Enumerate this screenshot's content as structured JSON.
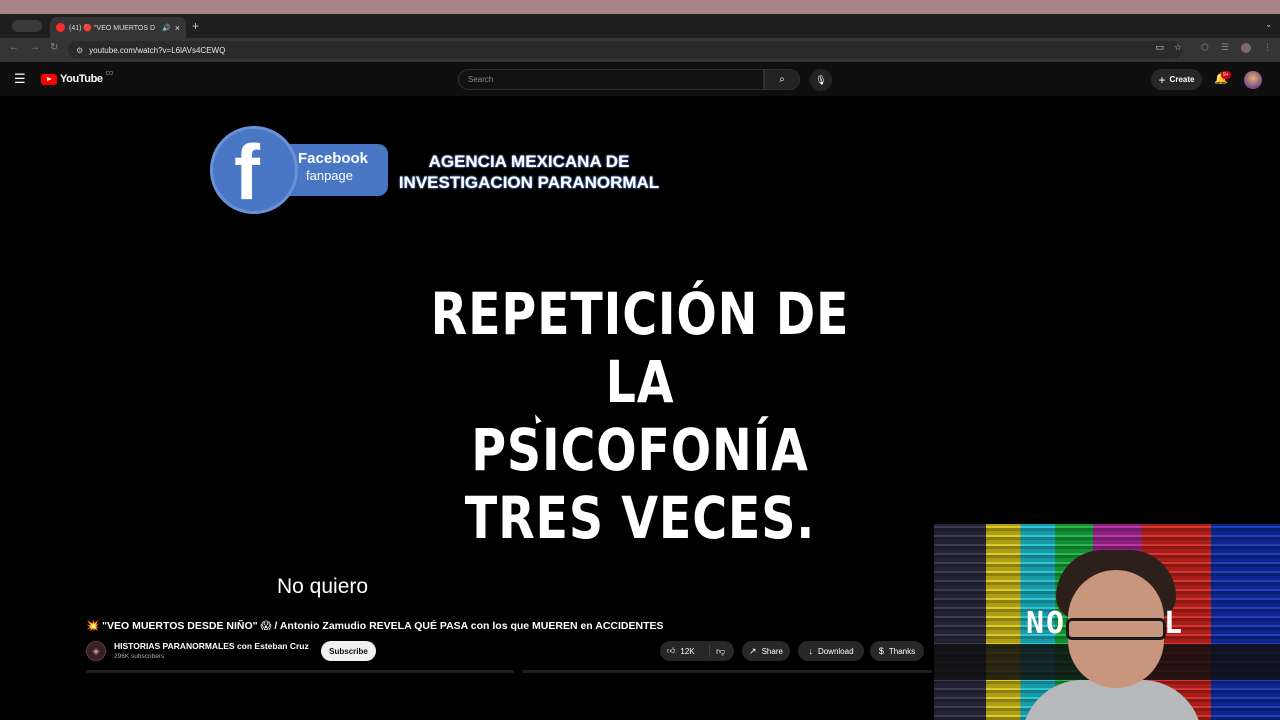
{
  "browser": {
    "tab": {
      "title": "(41) 🔴 \"VEO MUERTOS D",
      "close": "×",
      "audio_icon": "speaker-icon"
    },
    "new_tab": "+",
    "url": "youtube.com/watch?v=L6lAVs4CEWQ"
  },
  "youtube": {
    "logo_text": "YouTube",
    "logo_badge": "CO",
    "search_placeholder": "Search",
    "create_label": "Create",
    "notification_count": "9+"
  },
  "video": {
    "fb_name": "Facebook",
    "fb_sub": "fanpage",
    "fb_letter": "f",
    "agency_line1": "AGENCIA MEXICANA DE",
    "agency_line2": "INVESTIGACION PARANORMAL",
    "headline_line1": "REPETICIÓN DE LA",
    "headline_line2": "PSICOFONÍA TRES VECES.",
    "caption": "No quiero"
  },
  "webcam": {
    "signal_left": "NO",
    "signal_right": "L"
  },
  "info": {
    "title_prefix": "💥",
    "title": "\"VEO MUERTOS DESDE NIÑO\" 😱 / Antonio Zamudio REVELA QUÉ PASA con los que MUEREN en ACCIDENTES",
    "channel_name": "HISTORIAS PARANORMALES con Esteban Cruz",
    "subscribers": "296K subscribers",
    "subscribe_label": "Subscribe",
    "likes": "12K",
    "share_label": "Share",
    "download_label": "Download",
    "thanks_label": "Thanks"
  },
  "colors": {
    "yt_red": "#ff0000",
    "fb_blue": "#4a76c6",
    "header_bg": "#0f0f0f",
    "pill_bg": "#272727"
  }
}
